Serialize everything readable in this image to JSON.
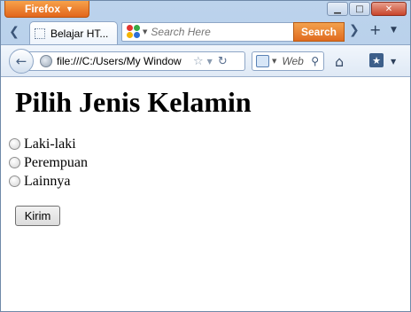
{
  "browser": {
    "app_button": "Firefox",
    "tab_title": "Belajar HT...",
    "search_placeholder": "Search Here",
    "search_button": "Search",
    "url": "file:///C:/Users/My Window",
    "web_search_label": "Web"
  },
  "page": {
    "heading": "Pilih Jenis Kelamin",
    "options": [
      "Laki-laki",
      "Perempuan",
      "Lainnya"
    ],
    "submit_label": "Kirim"
  }
}
